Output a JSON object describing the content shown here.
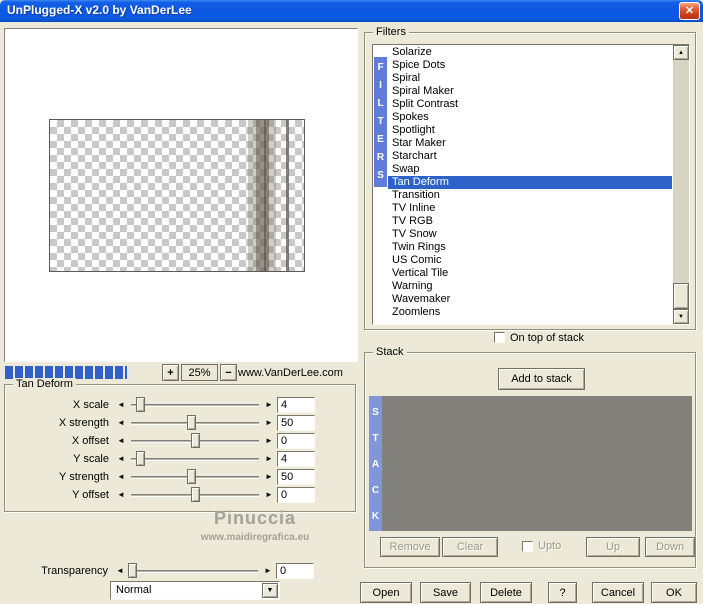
{
  "window": {
    "title": "UnPlugged-X v2.0 by VanDerLee"
  },
  "icons": {
    "close": "✕",
    "left": "◄",
    "right": "►",
    "up": "▲",
    "down": "▼"
  },
  "preview": {
    "zoom_in": "+",
    "zoom_level": "25%",
    "zoom_out": "−",
    "website": "www.VanDerLee.com"
  },
  "params": {
    "group_title": "Tan Deform",
    "rows": [
      {
        "label": "X scale",
        "value": "4",
        "thumb_pct": 8
      },
      {
        "label": "X strength",
        "value": "50",
        "thumb_pct": 47
      },
      {
        "label": "X offset",
        "value": "0",
        "thumb_pct": 50
      },
      {
        "label": "Y scale",
        "value": "4",
        "thumb_pct": 8
      },
      {
        "label": "Y strength",
        "value": "50",
        "thumb_pct": 47
      },
      {
        "label": "Y offset",
        "value": "0",
        "thumb_pct": 50
      }
    ],
    "transparency": {
      "label": "Transparency",
      "value": "0",
      "thumb_pct": 3
    },
    "blend_mode": "Normal"
  },
  "watermark": {
    "line1": "Pinuccia",
    "line2": "www.maidiregrafica.eu"
  },
  "filters": {
    "group_title": "Filters",
    "vertical_label": "FILTERS",
    "items": [
      "Solarize",
      "Spice Dots",
      "Spiral",
      "Spiral Maker",
      "Split Contrast",
      "Spokes",
      "Spotlight",
      "Star Maker",
      "Starchart",
      "Swap",
      "Tan Deform",
      "Transition",
      "TV Inline",
      "TV RGB",
      "TV Snow",
      "Twin Rings",
      "US Comic",
      "Vertical Tile",
      "Warning",
      "Wavemaker",
      "Zoomlens"
    ],
    "selected": "Tan Deform",
    "on_top_label": "On top of stack",
    "on_top_checked": false
  },
  "stack": {
    "group_title": "Stack",
    "vertical_label": "STACK",
    "add_button": "Add to stack",
    "remove_button": "Remove",
    "clear_button": "Clear",
    "upto_label": "Upto",
    "upto_checked": false,
    "up_button": "Up",
    "down_button": "Down"
  },
  "footer": {
    "open": "Open",
    "save": "Save",
    "delete": "Delete",
    "help": "?",
    "cancel": "Cancel",
    "ok": "OK"
  },
  "colors": {
    "dialog_bg": "#ece9d8",
    "titlebar_top": "#3d8af0",
    "titlebar_mid": "#0b57e0",
    "titlebar_bottom": "#0a4cc2",
    "selection_blue": "#2f62c9",
    "filters_bar_blue": "#5f7cd8",
    "stack_bar_blue": "#8096d8",
    "stack_area_gray": "#81807b",
    "quality_blue": "#3060c8",
    "watermark_gray": "#a5a196"
  }
}
